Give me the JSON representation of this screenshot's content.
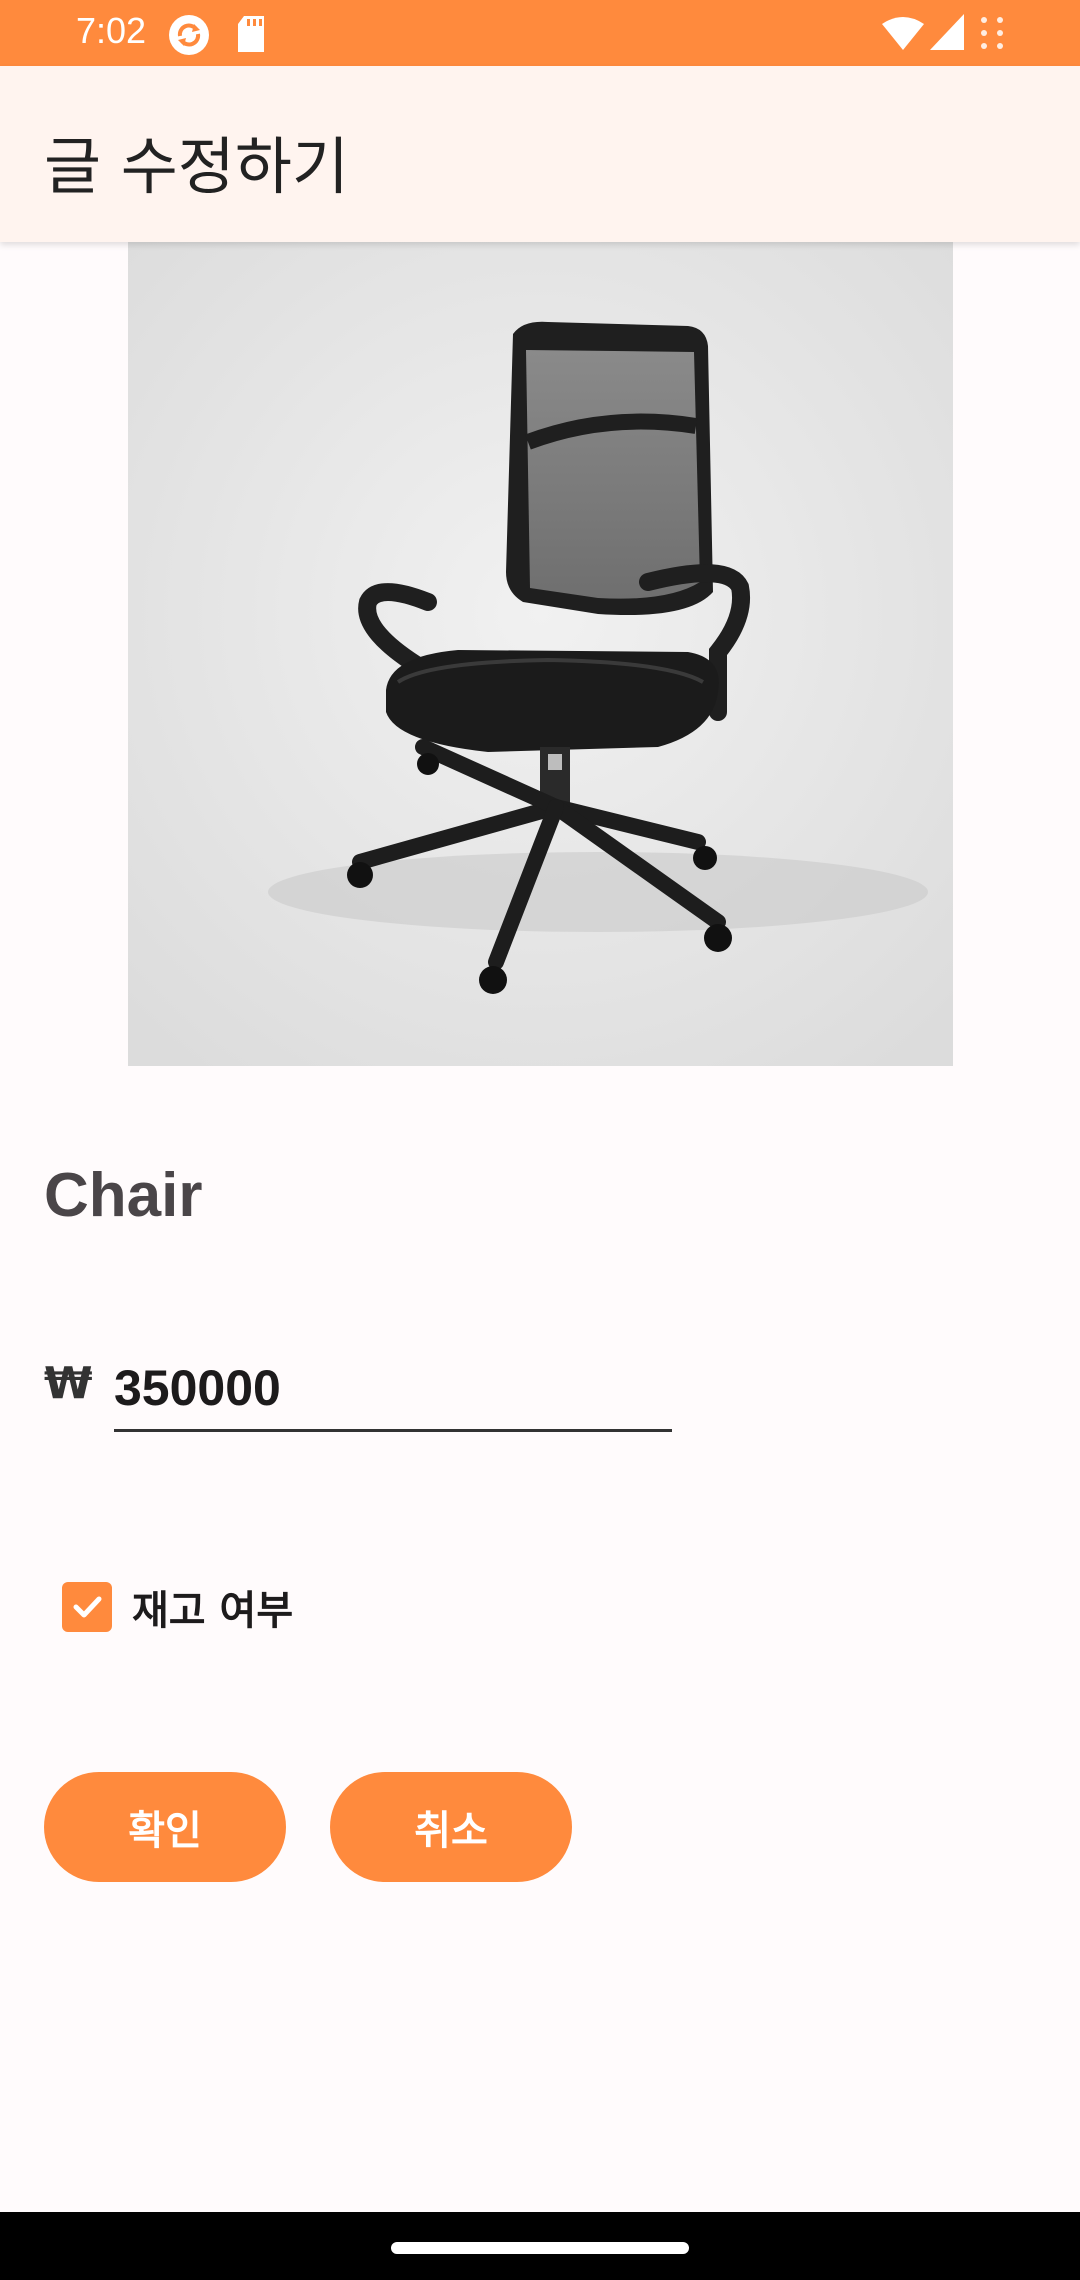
{
  "status_bar": {
    "time": "7:02",
    "icons_left": [
      "sync-icon",
      "sd-card-icon"
    ],
    "icons_right": [
      "wifi-icon",
      "cell-signal-icon",
      "dots-icon"
    ],
    "background": "#ff8a3d"
  },
  "app_bar": {
    "title": "글 수정하기",
    "background": "#fff4ef"
  },
  "product": {
    "image_alt": "office-chair",
    "name": "Chair"
  },
  "price": {
    "currency_symbol": "₩",
    "value": "350000"
  },
  "stock": {
    "label": "재고 여부",
    "checked": true
  },
  "buttons": {
    "confirm_label": "확인",
    "cancel_label": "취소"
  },
  "colors": {
    "accent": "#ff8a3d",
    "background": "#fffbfc"
  }
}
